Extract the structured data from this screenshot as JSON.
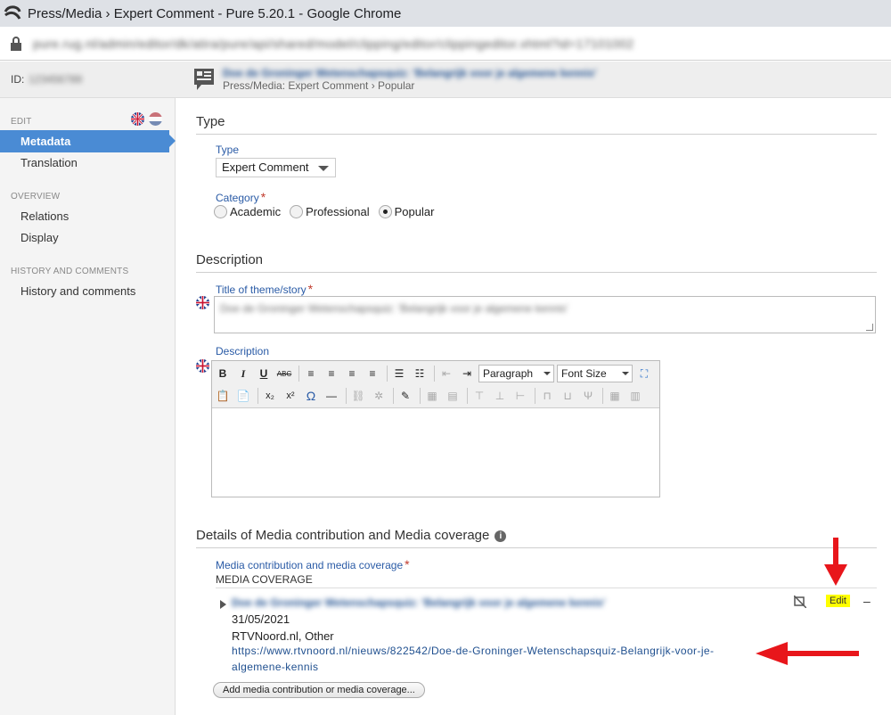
{
  "window": {
    "title": "Press/Media › Expert Comment - Pure 5.20.1 - Google Chrome"
  },
  "address_bar": {
    "url": "pure.rug.nl/admin/editor/dk/atira/pure/api/shared/model/clipping/editor/clippingeditor.xhtml?id=17101002"
  },
  "header": {
    "id_label": "ID:",
    "id_value": "123456789",
    "record_title": "Doe de Groninger Wetenschapsquiz: 'Belangrijk voor je algemene kennis'",
    "breadcrumb": "Press/Media: Expert Comment › Popular"
  },
  "sidebar": {
    "edit_section": "EDIT",
    "items_edit": [
      "Metadata",
      "Translation"
    ],
    "overview_section": "OVERVIEW",
    "items_overview": [
      "Relations",
      "Display"
    ],
    "history_section": "HISTORY AND COMMENTS",
    "items_history": [
      "History and comments"
    ]
  },
  "type_section": {
    "title": "Type",
    "type_label": "Type",
    "type_value": "Expert Comment",
    "category_label": "Category",
    "category_options": [
      "Academic",
      "Professional",
      "Popular"
    ],
    "category_selected": "Popular"
  },
  "description_section": {
    "title": "Description",
    "theme_label": "Title of theme/story",
    "theme_value": "Doe de Groninger Wetenschapsquiz: 'Belangrijk voor je algemene kennis'",
    "description_label": "Description",
    "paragraph_select": "Paragraph",
    "fontsize_select": "Font Size"
  },
  "media_section": {
    "title": "Details of Media contribution and Media coverage",
    "field_label": "Media contribution and media coverage",
    "value": "MEDIA COVERAGE",
    "item": {
      "title": "Doe de Groninger Wetenschapsquiz: 'Belangrijk voor je algemene kennis'",
      "date": "31/05/2021",
      "source": "RTVNoord.nl, Other",
      "url_part1": "https://www.rtvnoord.nl/nieuws/822542/Doe-de-Groninger-Wetenschapsquiz-Belangrijk-voor-je-",
      "url_part2": "algemene-kennis"
    },
    "edit_label": "Edit",
    "remove_label": "–",
    "add_label": "Add media contribution or media coverage..."
  },
  "colors": {
    "accent": "#4a8bd4",
    "link": "#1f4f8f",
    "required": "#c0392b",
    "highlight": "#ffff00",
    "annotation": "#e8161b"
  }
}
